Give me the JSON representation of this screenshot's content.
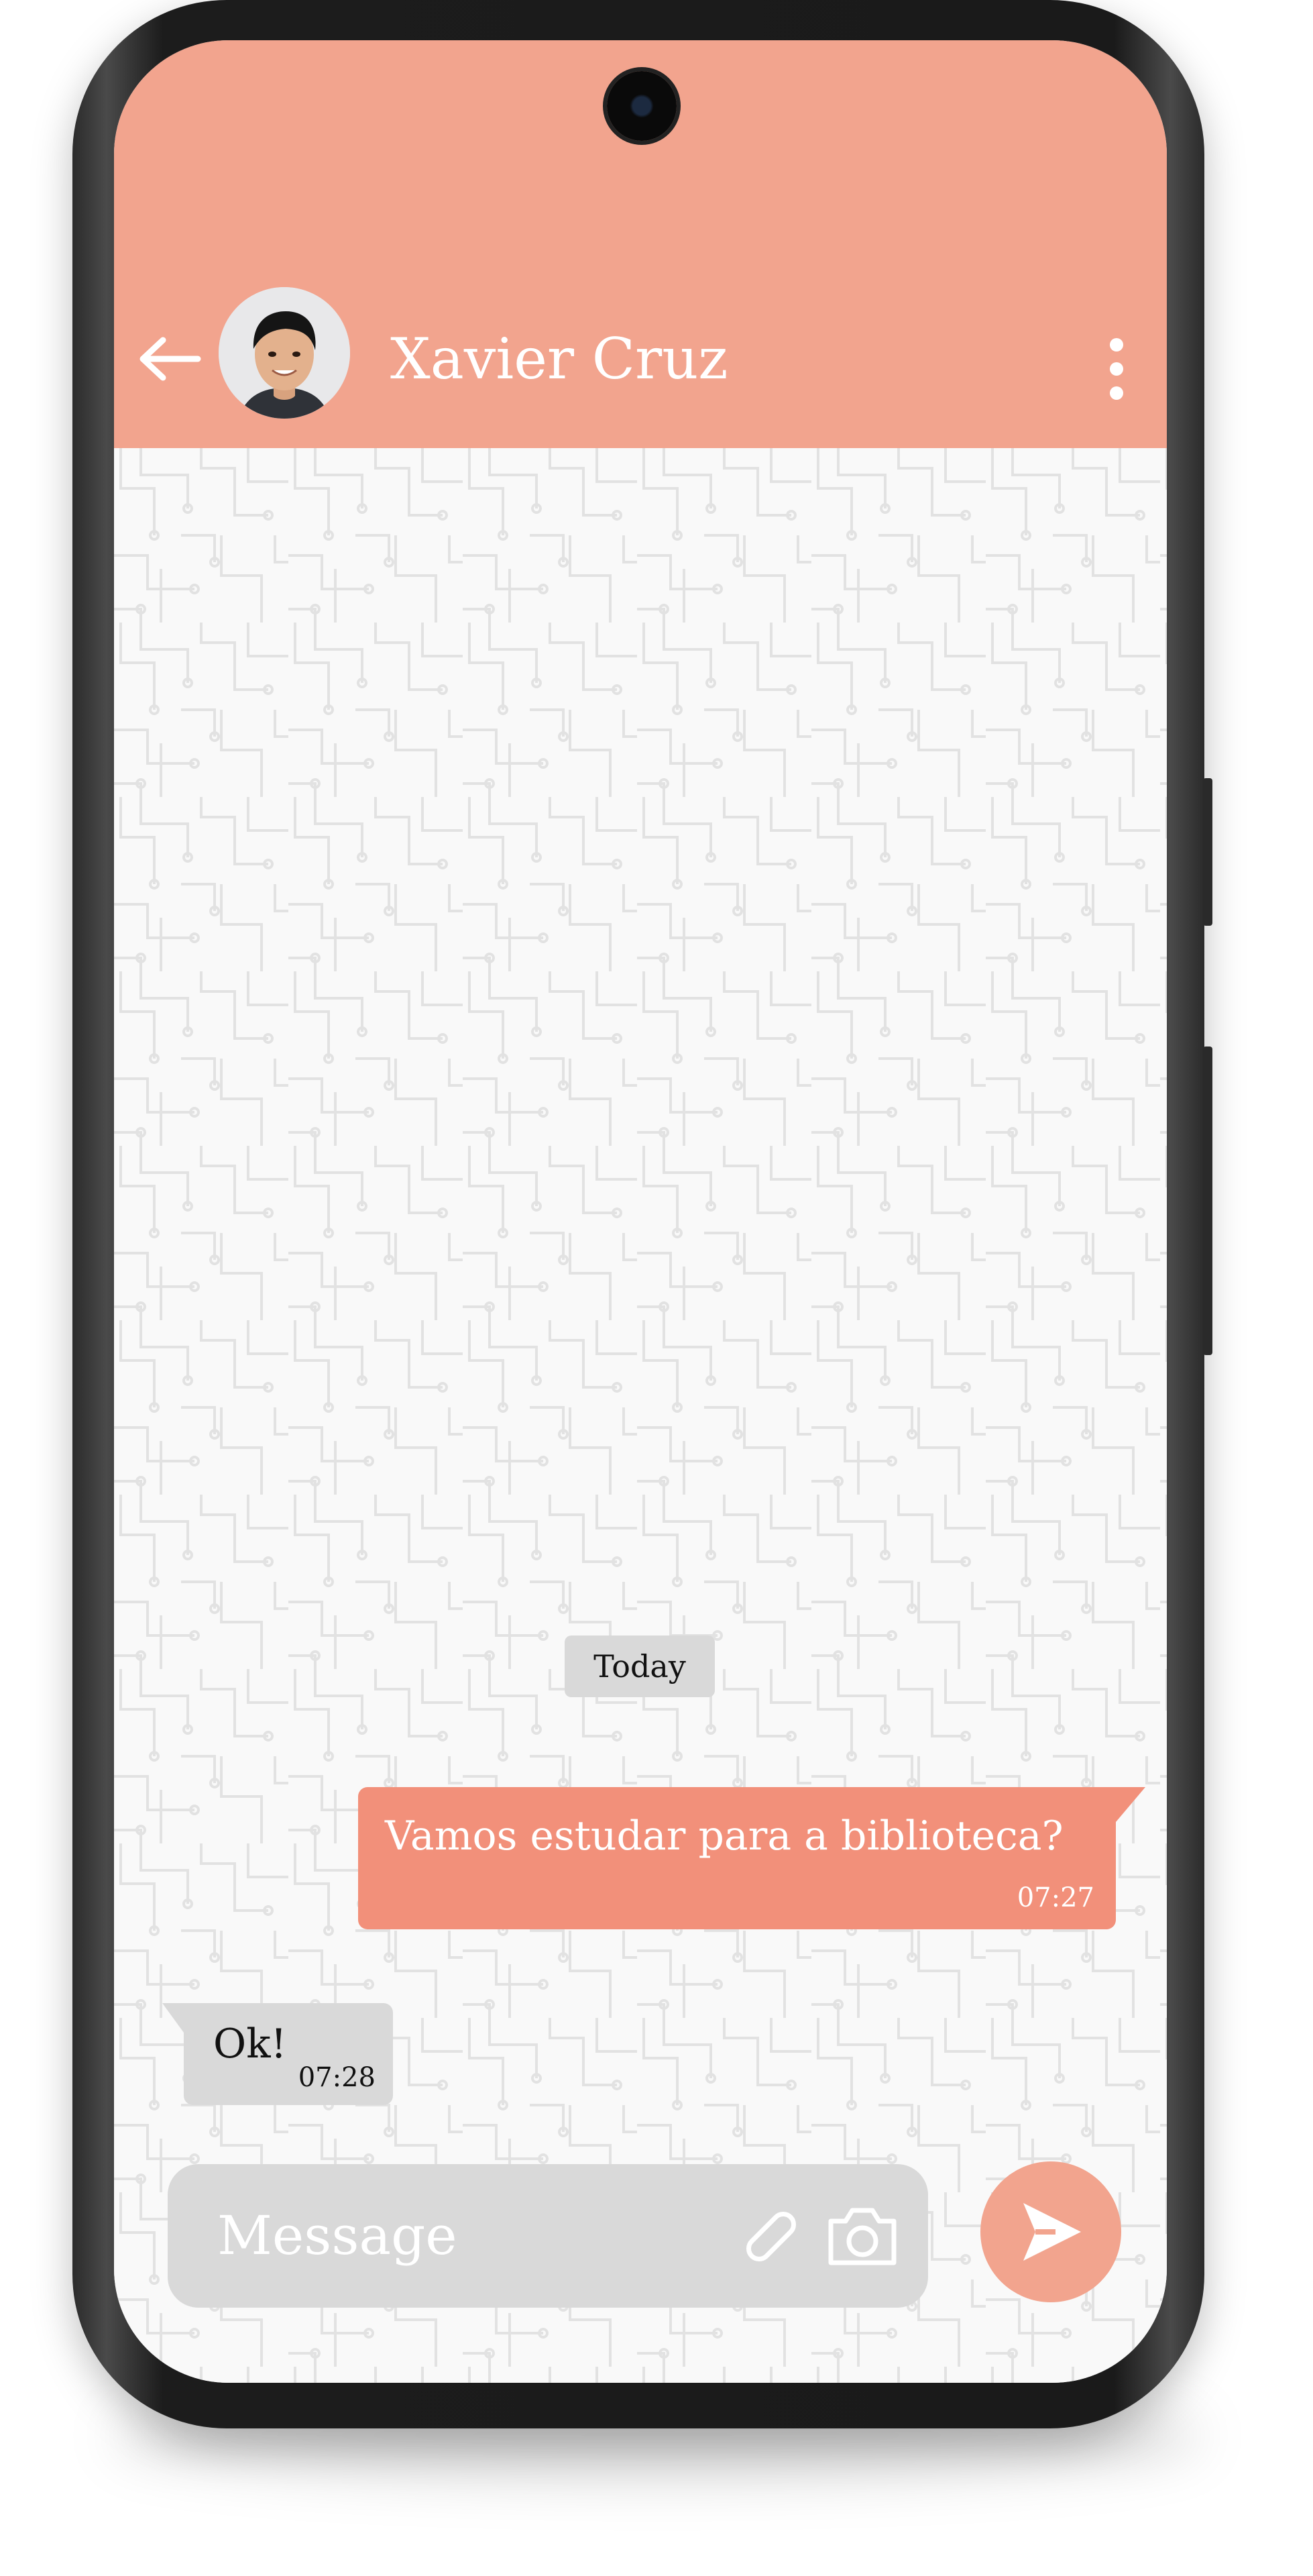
{
  "header": {
    "contact_name": "Xavier Cruz",
    "back_icon": "arrow-left-icon",
    "menu_icon": "more-vertical-icon",
    "avatar_alt": "Xavier Cruz avatar"
  },
  "chat": {
    "date_separator": "Today",
    "messages": [
      {
        "direction": "outgoing",
        "text": "Vamos estudar para a biblioteca?",
        "time": "07:27"
      },
      {
        "direction": "incoming",
        "text": "Ok!",
        "time": "07:28"
      }
    ]
  },
  "composer": {
    "placeholder": "Message",
    "attach_icon": "paperclip-icon",
    "camera_icon": "camera-icon",
    "send_icon": "send-icon"
  },
  "colors": {
    "accent": "#f2a48e",
    "outgoing_bubble": "#f2907a",
    "incoming_bubble": "#d9d9d9",
    "chat_background": "#f9f9f9"
  }
}
